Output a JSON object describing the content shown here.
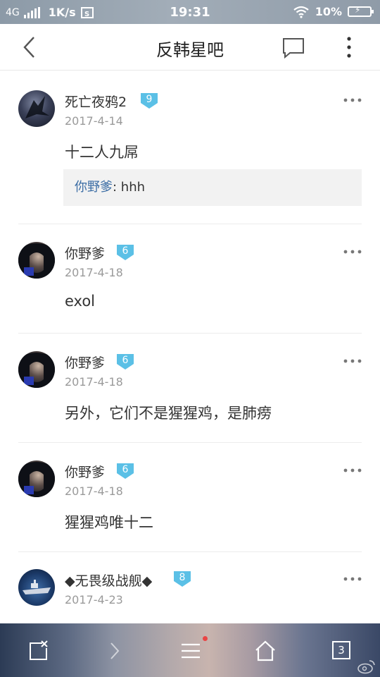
{
  "status_bar": {
    "network": "4G",
    "speed": "1K/s",
    "time": "19:31",
    "battery": "10%"
  },
  "header": {
    "title": "反韩星吧"
  },
  "posts": [
    {
      "username": "死亡夜鸦2",
      "level": "9",
      "date": "2017-4-14",
      "content": "十二人九屌",
      "reply": {
        "who": "你野爹",
        "sep": ":",
        "text": " hhh"
      }
    },
    {
      "username": "你野爹",
      "level": "6",
      "date": "2017-4-18",
      "content": "exol"
    },
    {
      "username": "你野爹",
      "level": "6",
      "date": "2017-4-18",
      "content": "另外，它们不是猩猩鸡，是肺痨"
    },
    {
      "username": "你野爹",
      "level": "6",
      "date": "2017-4-18",
      "content": "猩猩鸡唯十二"
    },
    {
      "username": "◆无畏级战舰◆",
      "level": "8",
      "date": "2017-4-23",
      "content": ""
    }
  ],
  "toolbar": {
    "tab_count": "3"
  },
  "colors": {
    "badge": "#5bc0e6",
    "reply_name": "#3d6ea5",
    "date": "#9a9a9a"
  }
}
